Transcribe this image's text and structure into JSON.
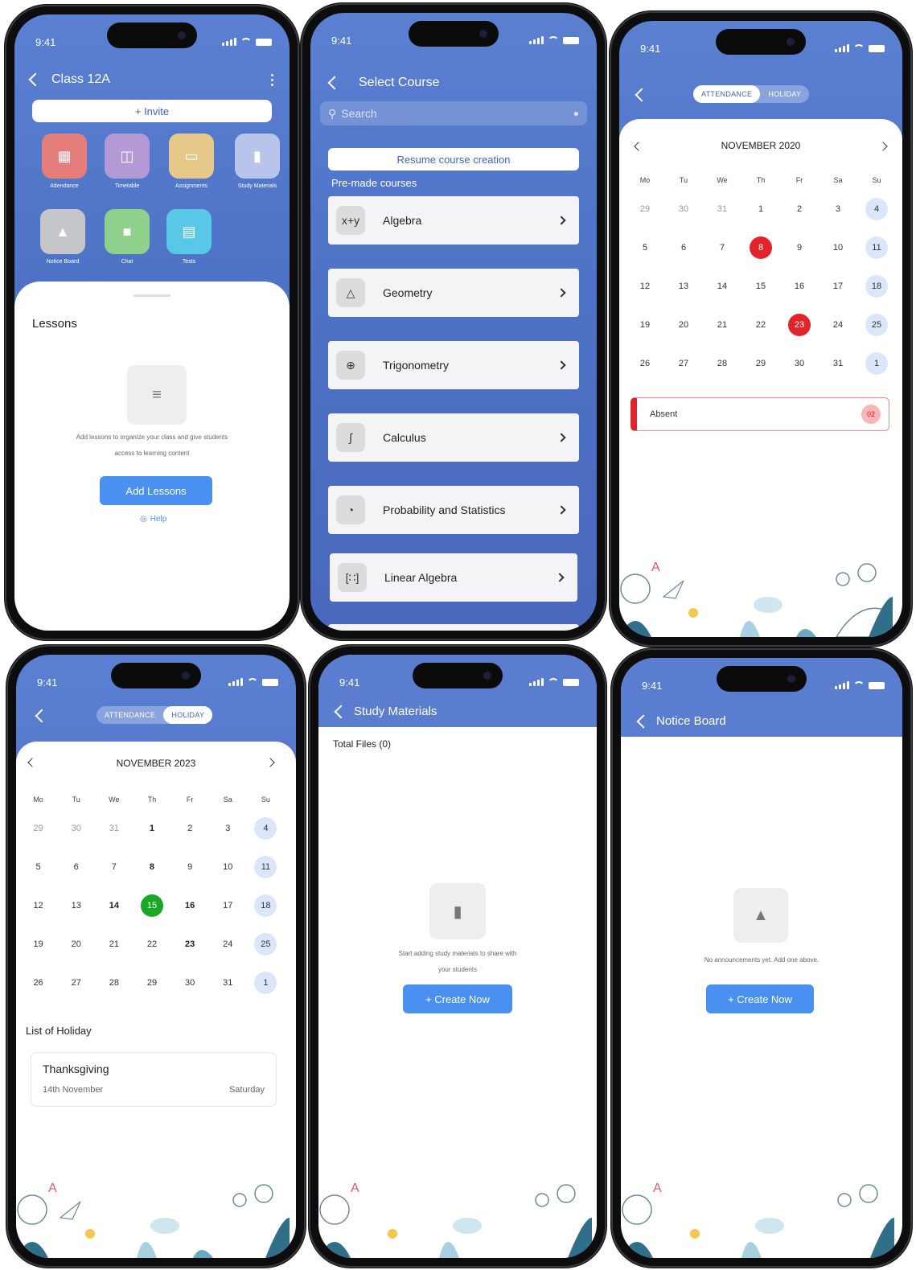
{
  "status_time": "9:41",
  "class_screen": {
    "title": "Class 12A",
    "invite_label": "+ Invite",
    "tiles": [
      {
        "label": "Attendance",
        "icon": "calendar-icon",
        "color": "#e57e7b"
      },
      {
        "label": "Timetable",
        "icon": "timetable-icon",
        "color": "#b39ad4"
      },
      {
        "label": "Assignments",
        "icon": "book-icon",
        "color": "#e6c98a"
      },
      {
        "label": "Study Materials",
        "icon": "folder-icon",
        "color": "#b8c4ea"
      },
      {
        "label": "Notice Board",
        "icon": "bell-icon",
        "color": "#c6c6ca"
      },
      {
        "label": "Chat",
        "icon": "chat-icon",
        "color": "#8fd18a"
      },
      {
        "label": "Tests",
        "icon": "clipboard-icon",
        "color": "#58c8e6"
      }
    ],
    "lessons_title": "Lessons",
    "empty_text_1": "Add lessons to organize your class and give students",
    "empty_text_2": "access to learning content",
    "add_lessons": "Add Lessons",
    "help": "Help"
  },
  "select_course": {
    "title": "Select Course",
    "search_placeholder": "Search",
    "resume": "Resume course creation",
    "premade_label": "Pre-made courses",
    "courses": [
      {
        "name": "Algebra",
        "icon": "algebra-icon"
      },
      {
        "name": "Geometry",
        "icon": "geometry-icon"
      },
      {
        "name": "Trigonometry",
        "icon": "trigonometry-icon"
      },
      {
        "name": "Calculus",
        "icon": "calculus-icon"
      },
      {
        "name": "Probability and Statistics",
        "icon": "statistics-icon"
      },
      {
        "name": "Linear Algebra",
        "icon": "matrix-icon"
      }
    ]
  },
  "attendance": {
    "seg_attendance": "ATTENDANCE",
    "seg_holiday": "HOLIDAY",
    "month": "NOVEMBER 2020",
    "dow": [
      "Mo",
      "Tu",
      "We",
      "Th",
      "Fr",
      "Sa",
      "Su"
    ],
    "days": [
      "29",
      "30",
      "31",
      "1",
      "2",
      "3",
      "4",
      "5",
      "6",
      "7",
      "8",
      "9",
      "10",
      "11",
      "12",
      "13",
      "14",
      "15",
      "16",
      "17",
      "18",
      "19",
      "20",
      "21",
      "22",
      "23",
      "24",
      "25",
      "26",
      "27",
      "28",
      "29",
      "30",
      "31",
      "1"
    ],
    "absent_label": "Absent",
    "absent_count": "02"
  },
  "holiday": {
    "seg_attendance": "ATTENDANCE",
    "seg_holiday": "HOLIDAY",
    "month": "NOVEMBER 2023",
    "dow": [
      "Mo",
      "Tu",
      "We",
      "Th",
      "Fr",
      "Sa",
      "Su"
    ],
    "days": [
      "29",
      "30",
      "31",
      "1",
      "2",
      "3",
      "4",
      "5",
      "6",
      "7",
      "8",
      "9",
      "10",
      "11",
      "12",
      "13",
      "14",
      "15",
      "16",
      "17",
      "18",
      "19",
      "20",
      "21",
      "22",
      "23",
      "24",
      "25",
      "26",
      "27",
      "28",
      "29",
      "30",
      "31",
      "1"
    ],
    "list_title": "List of Holiday",
    "holiday_name": "Thanksgiving",
    "holiday_date": "14th November",
    "holiday_day": "Saturday"
  },
  "study_materials": {
    "title": "Study Materials",
    "total_files": "Total Files (0)",
    "empty_1": "Start adding study materials to share with",
    "empty_2": "your students",
    "create": "+ Create Now"
  },
  "notice_board": {
    "title": "Notice Board",
    "empty": "No announcements yet. Add one above.",
    "create": "+ Create Now"
  },
  "colors": {
    "brand_blue": "#4f73c6",
    "button_blue": "#4a90f0",
    "absent_red": "#e3232a",
    "today_green": "#19a824"
  }
}
